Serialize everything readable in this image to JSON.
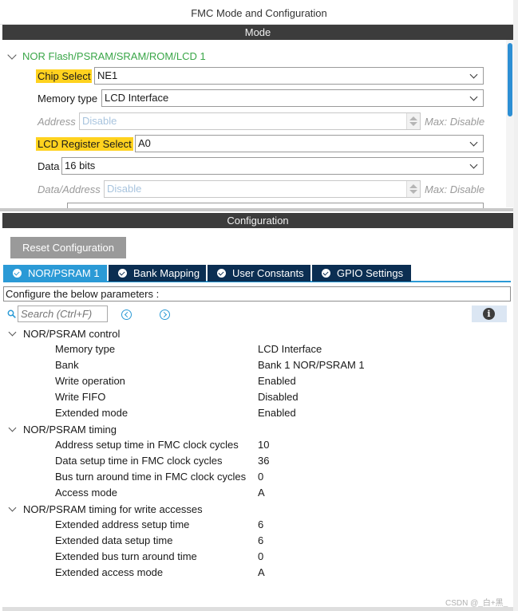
{
  "window": {
    "title": "FMC Mode and Configuration"
  },
  "mode": {
    "header": "Mode",
    "tree_label": "NOR Flash/PSRAM/SRAM/ROM/LCD 1",
    "fields": {
      "chip_select": {
        "label": "Chip Select",
        "value": "NE1"
      },
      "memory_type": {
        "label": "Memory type",
        "value": "LCD Interface"
      },
      "address": {
        "label": "Address",
        "value": "Disable",
        "max_label": "Max: Disable"
      },
      "lcd_register_select": {
        "label": "LCD Register Select",
        "value": "A0"
      },
      "data": {
        "label": "Data",
        "value": "16 bits"
      },
      "data_address": {
        "label": "Data/Address",
        "value": "Disable",
        "max_label": "Max: Disable"
      }
    }
  },
  "configuration": {
    "header": "Configuration",
    "reset_button": "Reset Configuration",
    "tabs": [
      {
        "label": "NOR/PSRAM 1",
        "active": true
      },
      {
        "label": "Bank Mapping",
        "active": false
      },
      {
        "label": "User Constants",
        "active": false
      },
      {
        "label": "GPIO Settings",
        "active": false
      }
    ],
    "caption": "Configure the below parameters :",
    "search_placeholder": "Search (Ctrl+F)",
    "info_glyph": "i",
    "groups": [
      {
        "title": "NOR/PSRAM control",
        "params": [
          {
            "name": "Memory type",
            "value": "LCD Interface"
          },
          {
            "name": "Bank",
            "value": "Bank 1 NOR/PSRAM 1"
          },
          {
            "name": "Write operation",
            "value": "Enabled"
          },
          {
            "name": "Write FIFO",
            "value": "Disabled"
          },
          {
            "name": "Extended mode",
            "value": "Enabled"
          }
        ]
      },
      {
        "title": "NOR/PSRAM timing",
        "params": [
          {
            "name": "Address setup time in FMC clock cycles",
            "value": "10"
          },
          {
            "name": "Data setup time in FMC clock cycles",
            "value": "36"
          },
          {
            "name": "Bus turn around time in FMC clock cycles",
            "value": "0"
          },
          {
            "name": "Access mode",
            "value": "A"
          }
        ]
      },
      {
        "title": "NOR/PSRAM timing for write accesses",
        "params": [
          {
            "name": "Extended address setup time",
            "value": "6"
          },
          {
            "name": "Extended data setup time",
            "value": "6"
          },
          {
            "name": "Extended bus turn around time",
            "value": "0"
          },
          {
            "name": "Extended access mode",
            "value": "A"
          }
        ]
      }
    ]
  },
  "watermark": "CSDN @_白+黑_",
  "colors": {
    "header_bar": "#3c3c3c",
    "highlight": "#ffd21f",
    "tree_green": "#3aa648",
    "tab_active": "#2b9ad6",
    "tab_inactive": "#0b2e52",
    "reset_button": "#9a9a9a"
  }
}
